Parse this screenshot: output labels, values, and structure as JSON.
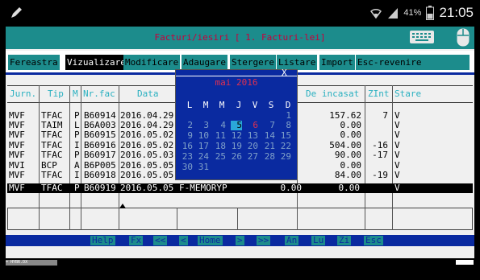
{
  "status_bar": {
    "battery": "41%",
    "time": "21:05",
    "icons": [
      "pen-icon",
      "wifi-icon",
      "signal-icon",
      "battery-icon"
    ]
  },
  "app": {
    "title": "Facturi/iesiri [ 1. Facturi-lei]",
    "title_icons": [
      "keyboard-icon",
      "mouse-icon"
    ]
  },
  "menu": [
    {
      "label": "Fereastra",
      "active": false
    },
    {
      "label": "Vizualizare",
      "active": true
    },
    {
      "label": "Modificare",
      "active": false
    },
    {
      "label": "Adaugare",
      "active": false
    },
    {
      "label": "Stergere",
      "active": false
    },
    {
      "label": "Listare",
      "active": false
    },
    {
      "label": "Import",
      "active": false
    },
    {
      "label": "Esc-revenire",
      "active": false
    }
  ],
  "table": {
    "headers": [
      "Jurn.",
      "Tip",
      "M",
      "Nr.fac",
      "Data",
      "De incasat",
      "ZInt",
      "Stare"
    ],
    "rows": [
      {
        "jurn": "MVF",
        "tip": "TFAC",
        "m": "P",
        "nr": "B60914",
        "data": "2016.04.29",
        "client": "",
        "suma": "",
        "incasat": "157.62",
        "zint": "7",
        "stare": "V",
        "selected": false
      },
      {
        "jurn": "MVF",
        "tip": "TAIM",
        "m": "L",
        "nr": "B6A003",
        "data": "2016.04.29",
        "client": "",
        "suma": "",
        "incasat": "0.00",
        "zint": "",
        "stare": "V",
        "selected": false
      },
      {
        "jurn": "MVF",
        "tip": "TFAC",
        "m": "P",
        "nr": "B60915",
        "data": "2016.05.02",
        "client": "",
        "suma": "",
        "incasat": "0.00",
        "zint": "",
        "stare": "V",
        "selected": false
      },
      {
        "jurn": "MVF",
        "tip": "TFAC",
        "m": "I",
        "nr": "B60916",
        "data": "2016.05.02",
        "client": "",
        "suma": "",
        "incasat": "504.00",
        "zint": "-16",
        "stare": "V",
        "selected": false
      },
      {
        "jurn": "MVF",
        "tip": "TFAC",
        "m": "P",
        "nr": "B60917",
        "data": "2016.05.03",
        "client": "",
        "suma": "",
        "incasat": "90.00",
        "zint": "-17",
        "stare": "V",
        "selected": false
      },
      {
        "jurn": "MVI",
        "tip": "BCP",
        "m": "A",
        "nr": "B6P005",
        "data": "2016.05.05",
        "client": "",
        "suma": "",
        "incasat": "0.00",
        "zint": "",
        "stare": "V",
        "selected": false
      },
      {
        "jurn": "MVF",
        "tip": "TFAC",
        "m": "I",
        "nr": "B60918",
        "data": "2016.05.05",
        "client": "",
        "suma": "",
        "incasat": "84.00",
        "zint": "-19",
        "stare": "V",
        "selected": false
      },
      {
        "jurn": "MVF",
        "tip": "TFAC",
        "m": "P",
        "nr": "B60919",
        "data": "2016.05.05",
        "client": "F-MEMORYP",
        "suma": "0.00",
        "incasat": "0.00",
        "zint": "",
        "stare": "V",
        "selected": true
      }
    ]
  },
  "calendar": {
    "title": "mai 2016",
    "close": "X",
    "weekdays": [
      "L",
      "M",
      "M",
      "J",
      "V",
      "S",
      "D"
    ],
    "weeks": [
      [
        "",
        "",
        "",
        "",
        "",
        "",
        "1"
      ],
      [
        "2",
        "3",
        "4",
        "5",
        "6",
        "7",
        "8"
      ],
      [
        "9",
        "10",
        "11",
        "12",
        "13",
        "14",
        "15"
      ],
      [
        "16",
        "17",
        "18",
        "19",
        "20",
        "21",
        "22"
      ],
      [
        "23",
        "24",
        "25",
        "26",
        "27",
        "28",
        "29"
      ],
      [
        "30",
        "31",
        "",
        "",
        "",
        "",
        ""
      ]
    ],
    "today": "5",
    "highlight_red": "6"
  },
  "function_keys": [
    "Help",
    "Fx",
    "<<",
    "<",
    "Home",
    ">",
    ">>",
    "An",
    "Lu",
    "Zi",
    "Esc"
  ],
  "taskbar": {
    "item": "= HYBR.DX"
  },
  "colors": {
    "teal": "#1c8c8c",
    "blue": "#0a2aa0",
    "title_red": "#c8003c",
    "header_cyan": "#2ab0c0",
    "today_bg": "#2aa8d8"
  }
}
